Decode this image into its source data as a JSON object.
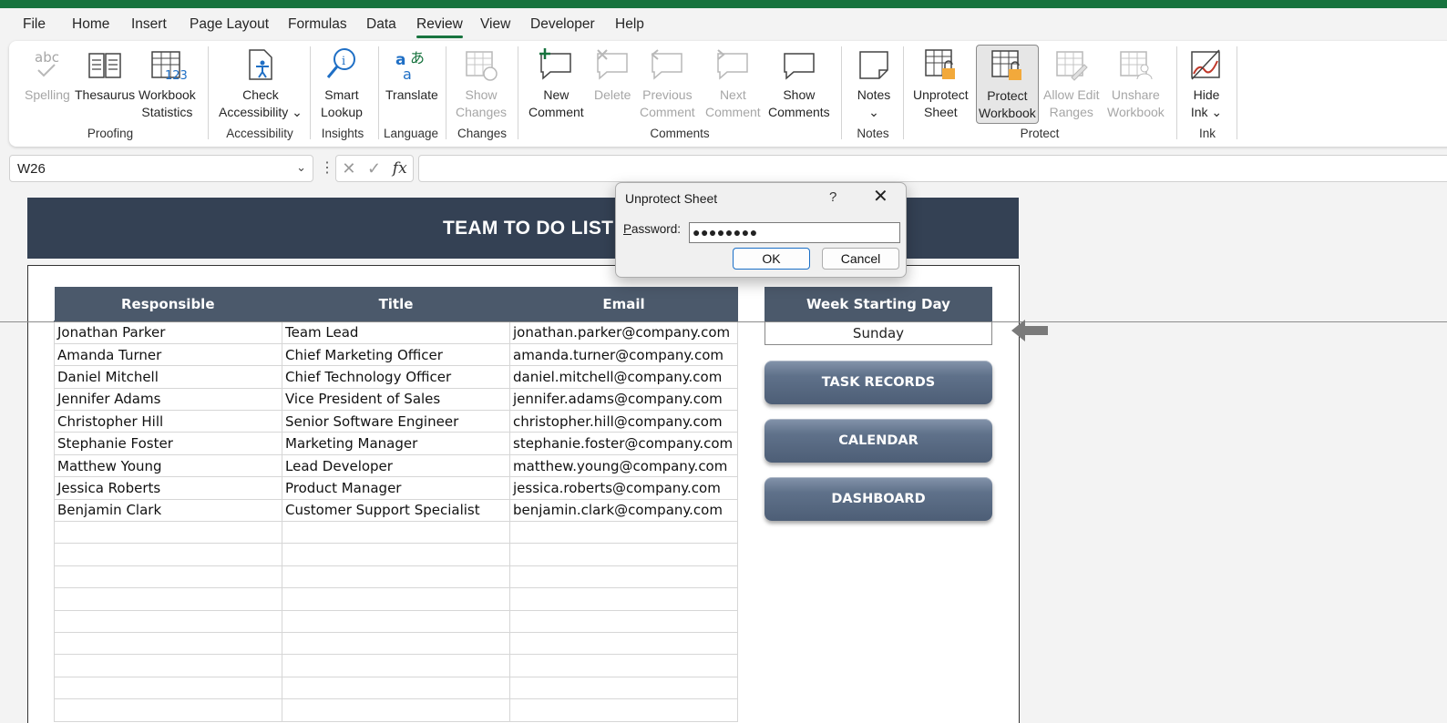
{
  "menu": {
    "tabs": [
      "File",
      "Home",
      "Insert",
      "Page Layout",
      "Formulas",
      "Data",
      "Review",
      "View",
      "Developer",
      "Help"
    ],
    "active": "Review"
  },
  "ribbon": {
    "proofing": {
      "label": "Proofing",
      "spelling": "Spelling",
      "spelling_icon_text": "abc",
      "thesaurus": "Thesaurus",
      "workbook_stats_1": "Workbook",
      "workbook_stats_2": "Statistics",
      "workbook_stats_icon_text": "123"
    },
    "accessibility": {
      "label": "Accessibility",
      "check_1": "Check",
      "check_2": "Accessibility ⌄"
    },
    "insights": {
      "label": "Insights",
      "smart_1": "Smart",
      "smart_2": "Lookup"
    },
    "language": {
      "label": "Language",
      "translate": "Translate"
    },
    "changes": {
      "label": "Changes",
      "show_1": "Show",
      "show_2": "Changes"
    },
    "comments": {
      "label": "Comments",
      "new_1": "New",
      "new_2": "Comment",
      "delete": "Delete",
      "prev_1": "Previous",
      "prev_2": "Comment",
      "next_1": "Next",
      "next_2": "Comment",
      "show_1": "Show",
      "show_2": "Comments"
    },
    "notes": {
      "label": "Notes",
      "notes": "Notes",
      "notes_2": "⌄"
    },
    "protect": {
      "label": "Protect",
      "unprotect_1": "Unprotect",
      "unprotect_2": "Sheet",
      "protect_1": "Protect",
      "protect_2": "Workbook",
      "allow_1": "Allow Edit",
      "allow_2": "Ranges",
      "unshare_1": "Unshare",
      "unshare_2": "Workbook"
    },
    "ink": {
      "label": "Ink",
      "hide_1": "Hide",
      "hide_2": "Ink ⌄"
    }
  },
  "formula_bar": {
    "name_box": "W26",
    "fx": "fx",
    "value": ""
  },
  "sheet": {
    "banner_title": "TEAM TO DO LIST",
    "table": {
      "headers": [
        "Responsible",
        "Title",
        "Email"
      ],
      "rows": [
        [
          "Jonathan Parker",
          "Team Lead",
          "jonathan.parker@company.com"
        ],
        [
          "Amanda Turner",
          "Chief Marketing Officer",
          "amanda.turner@company.com"
        ],
        [
          "Daniel Mitchell",
          "Chief Technology Officer",
          "daniel.mitchell@company.com"
        ],
        [
          "Jennifer Adams",
          "Vice President of Sales",
          "jennifer.adams@company.com"
        ],
        [
          "Christopher Hill",
          "Senior Software Engineer",
          "christopher.hill@company.com"
        ],
        [
          "Stephanie Foster",
          "Marketing Manager",
          "stephanie.foster@company.com"
        ],
        [
          "Matthew Young",
          "Lead Developer",
          "matthew.young@company.com"
        ],
        [
          "Jessica Roberts",
          "Product Manager",
          "jessica.roberts@company.com"
        ],
        [
          "Benjamin Clark",
          "Customer Support Specialist",
          "benjamin.clark@company.com"
        ],
        [
          "",
          "",
          ""
        ],
        [
          "",
          "",
          ""
        ],
        [
          "",
          "",
          ""
        ],
        [
          "",
          "",
          ""
        ],
        [
          "",
          "",
          ""
        ],
        [
          "",
          "",
          ""
        ],
        [
          "",
          "",
          ""
        ],
        [
          "",
          "",
          ""
        ],
        [
          "",
          "",
          ""
        ]
      ]
    },
    "week_header": "Week Starting Day",
    "week_value": "Sunday",
    "buttons": [
      "TASK RECORDS",
      "CALENDAR",
      "DASHBOARD"
    ]
  },
  "dialog": {
    "title": "Unprotect Sheet",
    "help": "?",
    "close": "✕",
    "password_label_first": "P",
    "password_label_rest": "assword:",
    "password_value": "●●●●●●●●",
    "ok": "OK",
    "cancel": "Cancel"
  },
  "colors": {
    "accent": "#17733e",
    "header_dark": "#344154",
    "table_header": "#4b596b"
  }
}
